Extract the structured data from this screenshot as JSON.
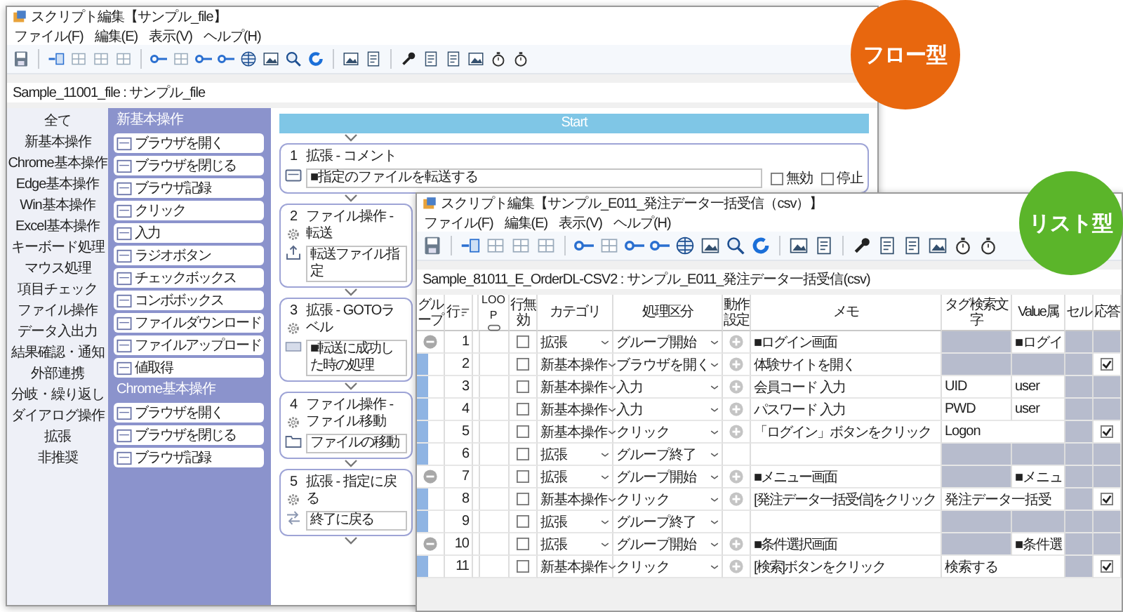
{
  "back_window": {
    "title": "スクリプト編集【サンプル_file】",
    "menu": [
      "ファイル(F)",
      "編集(E)",
      "表示(V)",
      "ヘルプ(H)"
    ],
    "path": "Sample_11001_file : サンプル_file",
    "categories": [
      "全て",
      "新基本操作",
      "Chrome基本操作",
      "Edge基本操作",
      "Win基本操作",
      "Excel基本操作",
      "キーボード処理",
      "マウス処理",
      "項目チェック",
      "ファイル操作",
      "データ入出力",
      "結果確認・通知",
      "外部連携",
      "分岐・繰り返し",
      "ダイアログ操作",
      "拡張",
      "非推奨"
    ],
    "palette": [
      {
        "kind": "header",
        "label": "新基本操作"
      },
      {
        "kind": "item",
        "label": "ブラウザを開く"
      },
      {
        "kind": "item",
        "label": "ブラウザを閉じる"
      },
      {
        "kind": "item",
        "label": "ブラウザ記録"
      },
      {
        "kind": "item",
        "label": "クリック"
      },
      {
        "kind": "item",
        "label": "入力"
      },
      {
        "kind": "item",
        "label": "ラジオボタン"
      },
      {
        "kind": "item",
        "label": "チェックボックス"
      },
      {
        "kind": "item",
        "label": "コンボボックス"
      },
      {
        "kind": "item",
        "label": "ファイルダウンロード"
      },
      {
        "kind": "item",
        "label": "ファイルアップロード"
      },
      {
        "kind": "item",
        "label": "値取得"
      },
      {
        "kind": "header",
        "label": "Chrome基本操作"
      },
      {
        "kind": "item",
        "label": "ブラウザを開く"
      },
      {
        "kind": "item",
        "label": "ブラウザを閉じる"
      },
      {
        "kind": "item",
        "label": "ブラウザ記録"
      }
    ],
    "start": "Start",
    "steps": [
      {
        "kind": "comment",
        "number": "1",
        "label": "拡張 - コメント",
        "value": "■指定のファイルを転送する",
        "options": [
          {
            "label": "無効",
            "checked": false
          },
          {
            "label": "停止",
            "checked": false
          }
        ]
      },
      {
        "kind": "transfer",
        "number": "2",
        "label": "ファイル操作 - 転送",
        "value": "転送ファイル指定"
      },
      {
        "kind": "label",
        "number": "3",
        "label": "拡張 - GOTOラベル",
        "value": "■転送に成功した時の処理"
      },
      {
        "kind": "move",
        "number": "4",
        "label": "ファイル操作 - ファイル移動",
        "value": "ファイルの移動"
      },
      {
        "kind": "return",
        "number": "5",
        "label": "拡張 - 指定に戻る",
        "value": "終了に戻る"
      }
    ]
  },
  "front_window": {
    "title": "スクリプト編集【サンプル_E011_発注データ一括受信（csv）】",
    "menu": [
      "ファイル(F)",
      "編集(E)",
      "表示(V)",
      "ヘルプ(H)"
    ],
    "path": "Sample_81011_E_OrderDL-CSV2 : サンプル_E011_発注データ一括受信(csv)",
    "columns": [
      "グループ",
      "行",
      "LOOP",
      "行無効",
      "カテゴリ",
      "処理区分",
      "動作設定",
      "メモ",
      "タグ検索文字",
      "Value属",
      "セル",
      "応答"
    ],
    "rows": [
      {
        "kind": "start",
        "number": "1",
        "disabled": false,
        "category": "拡張",
        "process": "グループ開始",
        "action": true,
        "memo": "■ログイン画面",
        "value": "■ログイ",
        "response_checked": false
      },
      {
        "kind": "member",
        "number": "2",
        "disabled": false,
        "category": "新基本操作",
        "process": "ブラウザを開く",
        "action": true,
        "memo": "体験サイトを開く",
        "response_checked": true
      },
      {
        "kind": "member",
        "number": "3",
        "disabled": false,
        "category": "新基本操作",
        "process": "入力",
        "action": true,
        "memo": "会員コード 入力",
        "tag": "UID",
        "value": "user",
        "response_checked": false
      },
      {
        "kind": "member",
        "number": "4",
        "disabled": false,
        "category": "新基本操作",
        "process": "入力",
        "action": true,
        "memo": "パスワード 入力",
        "tag": "PWD",
        "value": "user",
        "response_checked": false
      },
      {
        "kind": "member",
        "number": "5",
        "disabled": false,
        "category": "新基本操作",
        "process": "クリック",
        "action": true,
        "memo": "「ログイン」ボタンをクリック",
        "tag": "Logon",
        "response_checked": true
      },
      {
        "kind": "member",
        "number": "6",
        "disabled": false,
        "category": "拡張",
        "process": "グループ終了",
        "action": false,
        "response_checked": false
      },
      {
        "kind": "start",
        "number": "7",
        "disabled": false,
        "category": "拡張",
        "process": "グループ開始",
        "action": true,
        "memo": "■メニュー画面",
        "value": "■メニュ",
        "response_checked": false
      },
      {
        "kind": "member",
        "number": "8",
        "disabled": false,
        "category": "新基本操作",
        "process": "クリック",
        "action": true,
        "memo": "[発注データ一括受信]をクリック",
        "tag": "発注データ一括受",
        "response_checked": true
      },
      {
        "kind": "member",
        "number": "9",
        "disabled": false,
        "category": "拡張",
        "process": "グループ終了",
        "action": false,
        "response_checked": false
      },
      {
        "kind": "start",
        "number": "10",
        "disabled": false,
        "category": "拡張",
        "process": "グループ開始",
        "action": true,
        "memo": "■条件選択画面",
        "value": "■条件選",
        "response_checked": false
      },
      {
        "kind": "member",
        "number": "11",
        "disabled": false,
        "category": "新基本操作",
        "process": "クリック",
        "action": true,
        "memo": "[検索]ボタンをクリック",
        "tag": "検索する",
        "response_checked": true
      }
    ]
  },
  "badges": [
    {
      "kind": "flow",
      "label": "フロー型"
    },
    {
      "kind": "list",
      "label": "リスト型"
    }
  ]
}
